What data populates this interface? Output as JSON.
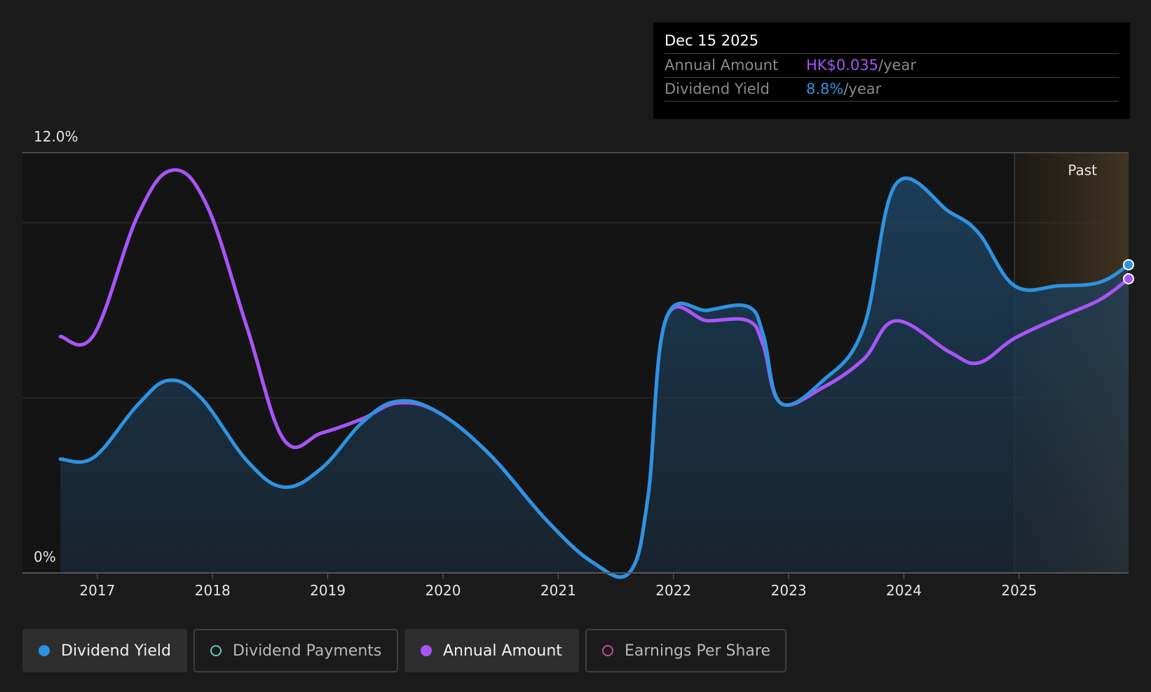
{
  "tooltip": {
    "date": "Dec 15 2025",
    "annual_amount_label": "Annual Amount",
    "annual_amount_value": "HK$0.035",
    "annual_amount_unit": "/year",
    "dividend_yield_label": "Dividend Yield",
    "dividend_yield_value": "8.8%",
    "dividend_yield_unit": "/year"
  },
  "legend": [
    {
      "label": "Dividend Yield",
      "color": "#2e93e0",
      "active": true
    },
    {
      "label": "Dividend Payments",
      "color": "#5ec8b8",
      "active": false
    },
    {
      "label": "Annual Amount",
      "color": "#a855f7",
      "active": true
    },
    {
      "label": "Earnings Per Share",
      "color": "#c0508a",
      "active": false
    }
  ],
  "chart_data": {
    "type": "line",
    "x_ticks": [
      "2017",
      "2018",
      "2019",
      "2020",
      "2021",
      "2022",
      "2023",
      "2024",
      "2025"
    ],
    "y_tick_labels": [
      "12.0%",
      "0%"
    ],
    "ylim": [
      0,
      12
    ],
    "xlim": [
      2016.35,
      2025.95
    ],
    "grid": true,
    "past_label": "Past",
    "past_region_start": 2024.96,
    "series": [
      {
        "name": "Dividend Yield",
        "color": "#2e93e0",
        "filled": true,
        "points": [
          [
            2016.68,
            3.25
          ],
          [
            2016.97,
            3.3
          ],
          [
            2017.35,
            4.8
          ],
          [
            2017.62,
            5.5
          ],
          [
            2017.9,
            5.0
          ],
          [
            2018.3,
            3.2
          ],
          [
            2018.62,
            2.45
          ],
          [
            2018.95,
            3.0
          ],
          [
            2019.3,
            4.3
          ],
          [
            2019.6,
            4.9
          ],
          [
            2019.95,
            4.6
          ],
          [
            2020.4,
            3.4
          ],
          [
            2020.9,
            1.5
          ],
          [
            2021.3,
            0.3
          ],
          [
            2021.62,
            0.02
          ],
          [
            2021.78,
            2.2
          ],
          [
            2021.93,
            7.2
          ],
          [
            2022.3,
            7.5
          ],
          [
            2022.65,
            7.6
          ],
          [
            2022.78,
            6.8
          ],
          [
            2022.93,
            4.85
          ],
          [
            2023.3,
            5.5
          ],
          [
            2023.65,
            7.0
          ],
          [
            2023.93,
            11.1
          ],
          [
            2024.4,
            10.3
          ],
          [
            2024.65,
            9.7
          ],
          [
            2024.96,
            8.2
          ],
          [
            2025.35,
            8.2
          ],
          [
            2025.7,
            8.3
          ],
          [
            2025.95,
            8.8
          ]
        ]
      },
      {
        "name": "Annual Amount",
        "color": "#a855f7",
        "filled": false,
        "points": [
          [
            2016.68,
            6.75
          ],
          [
            2016.97,
            6.8
          ],
          [
            2017.35,
            10.2
          ],
          [
            2017.65,
            11.5
          ],
          [
            2017.95,
            10.5
          ],
          [
            2018.3,
            7.0
          ],
          [
            2018.62,
            3.8
          ],
          [
            2018.95,
            4.0
          ],
          [
            2019.3,
            4.4
          ],
          [
            2019.6,
            4.85
          ],
          [
            2019.95,
            4.6
          ],
          [
            2020.4,
            3.4
          ],
          [
            2020.9,
            1.5
          ],
          [
            2021.3,
            0.3
          ],
          [
            2021.62,
            0.02
          ],
          [
            2021.78,
            2.2
          ],
          [
            2021.93,
            7.2
          ],
          [
            2022.3,
            7.2
          ],
          [
            2022.65,
            7.2
          ],
          [
            2022.78,
            6.5
          ],
          [
            2022.93,
            4.85
          ],
          [
            2023.3,
            5.3
          ],
          [
            2023.65,
            6.1
          ],
          [
            2023.93,
            7.2
          ],
          [
            2024.4,
            6.3
          ],
          [
            2024.65,
            6.0
          ],
          [
            2024.96,
            6.7
          ],
          [
            2025.35,
            7.3
          ],
          [
            2025.7,
            7.8
          ],
          [
            2025.95,
            8.4
          ]
        ]
      }
    ]
  }
}
